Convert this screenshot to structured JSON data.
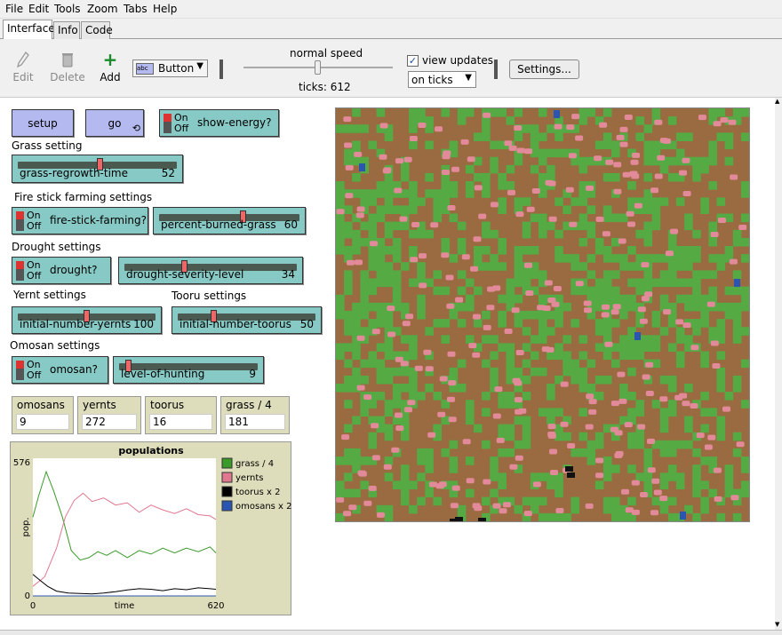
{
  "menubar": {
    "items": [
      "File",
      "Edit",
      "Tools",
      "Zoom",
      "Tabs",
      "Help"
    ]
  },
  "tabs": [
    "Interface",
    "Info",
    "Code"
  ],
  "toolbar": {
    "edit": "Edit",
    "delete": "Delete",
    "add": "Add",
    "widget_type": "Button",
    "speed_label": "normal speed",
    "ticks": "ticks: 612",
    "view_updates": "view updates",
    "update_mode": "on ticks",
    "settings": "Settings..."
  },
  "buttons": {
    "setup": "setup",
    "go": "go"
  },
  "switches": {
    "show_energy": "show-energy?",
    "fire": "fire-stick-farming?",
    "drought": "drought?",
    "omosan": "omosan?",
    "on": "On",
    "off": "Off"
  },
  "notes": {
    "grass": "Grass setting",
    "fire": "Fire stick farming settings",
    "drought": "Drought settings",
    "yernt": "Yernt settings",
    "tooru": "Tooru settings",
    "omosan": "Omosan settings"
  },
  "sliders": {
    "grass_regrowth": {
      "name": "grass-regrowth-time",
      "value": "52",
      "fraction": 0.52
    },
    "percent_burned": {
      "name": "percent-burned-grass",
      "value": "60",
      "fraction": 0.6
    },
    "drought_severity": {
      "name": "drought-severity-level",
      "value": "34",
      "fraction": 0.34
    },
    "initial_yernts": {
      "name": "initial-number-yernts",
      "value": "100",
      "fraction": 0.5
    },
    "initial_toorus": {
      "name": "initial-number-toorus",
      "value": "50",
      "fraction": 0.25
    },
    "level_hunting": {
      "name": "level-of-hunting",
      "value": "9",
      "fraction": 0.05
    }
  },
  "monitors": [
    {
      "label": "omosans",
      "value": "9"
    },
    {
      "label": "yernts",
      "value": "272"
    },
    {
      "label": "toorus",
      "value": "16"
    },
    {
      "label": "grass / 4",
      "value": "181"
    }
  ],
  "chart_data": {
    "type": "line",
    "title": "populations",
    "xlabel": "time",
    "ylabel": "pop.",
    "xlim": [
      0,
      620
    ],
    "ylim": [
      0,
      576
    ],
    "x_tick_labels": [
      "0",
      "620"
    ],
    "y_tick_labels": [
      "0",
      "576"
    ],
    "legend": "right",
    "series": [
      {
        "name": "grass / 4",
        "color": "#3a9a2a",
        "points": [
          [
            0,
            330
          ],
          [
            20,
            420
          ],
          [
            45,
            520
          ],
          [
            70,
            440
          ],
          [
            100,
            330
          ],
          [
            130,
            190
          ],
          [
            160,
            150
          ],
          [
            190,
            160
          ],
          [
            220,
            185
          ],
          [
            250,
            170
          ],
          [
            280,
            190
          ],
          [
            320,
            160
          ],
          [
            360,
            190
          ],
          [
            400,
            175
          ],
          [
            440,
            200
          ],
          [
            480,
            180
          ],
          [
            520,
            200
          ],
          [
            560,
            185
          ],
          [
            600,
            205
          ],
          [
            620,
            180
          ]
        ]
      },
      {
        "name": "yernts",
        "color": "#e07890",
        "points": [
          [
            0,
            40
          ],
          [
            40,
            80
          ],
          [
            80,
            200
          ],
          [
            110,
            330
          ],
          [
            140,
            400
          ],
          [
            170,
            430
          ],
          [
            200,
            395
          ],
          [
            240,
            410
          ],
          [
            280,
            380
          ],
          [
            320,
            390
          ],
          [
            360,
            350
          ],
          [
            400,
            380
          ],
          [
            440,
            360
          ],
          [
            480,
            345
          ],
          [
            520,
            365
          ],
          [
            560,
            340
          ],
          [
            600,
            335
          ],
          [
            620,
            320
          ]
        ]
      },
      {
        "name": "toorus x 2",
        "color": "#000000",
        "points": [
          [
            0,
            90
          ],
          [
            20,
            70
          ],
          [
            50,
            40
          ],
          [
            80,
            20
          ],
          [
            120,
            12
          ],
          [
            160,
            10
          ],
          [
            200,
            8
          ],
          [
            240,
            12
          ],
          [
            280,
            18
          ],
          [
            320,
            25
          ],
          [
            360,
            30
          ],
          [
            400,
            28
          ],
          [
            440,
            22
          ],
          [
            480,
            30
          ],
          [
            520,
            26
          ],
          [
            560,
            34
          ],
          [
            600,
            30
          ],
          [
            620,
            28
          ]
        ]
      },
      {
        "name": "omosans x 2",
        "color": "#2a55b0",
        "points": [
          [
            0,
            0
          ],
          [
            620,
            0
          ]
        ]
      }
    ]
  }
}
